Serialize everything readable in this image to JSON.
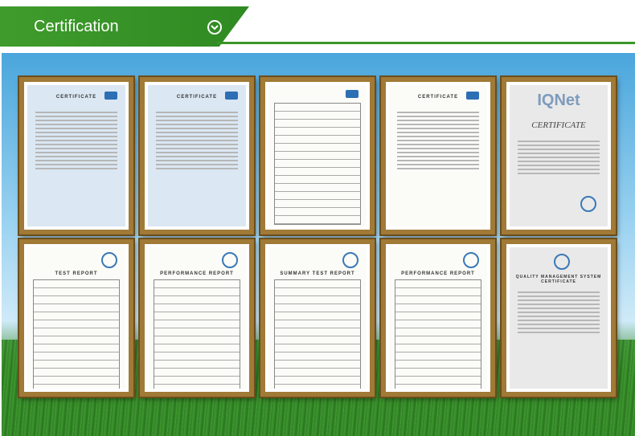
{
  "header": {
    "title": "Certification"
  },
  "certificates": [
    {
      "id": "c1",
      "heading": "CERTIFICATE",
      "style": "blue"
    },
    {
      "id": "c2",
      "heading": "CERTIFICATE",
      "style": "blue"
    },
    {
      "id": "c3",
      "heading": "",
      "style": "white"
    },
    {
      "id": "c4",
      "heading": "CERTIFICATE",
      "style": "white"
    },
    {
      "id": "c5",
      "heading": "CERTIFICATE",
      "logo": "IQNet",
      "style": "grey"
    },
    {
      "id": "c6",
      "heading": "TEST REPORT",
      "style": "white"
    },
    {
      "id": "c7",
      "heading": "PERFORMANCE REPORT",
      "style": "white"
    },
    {
      "id": "c8",
      "heading": "SUMMARY TEST REPORT",
      "style": "white"
    },
    {
      "id": "c9",
      "heading": "PERFORMANCE REPORT",
      "style": "white"
    },
    {
      "id": "c10",
      "heading": "QUALITY MANAGEMENT SYSTEM CERTIFICATE",
      "style": "grey"
    }
  ]
}
